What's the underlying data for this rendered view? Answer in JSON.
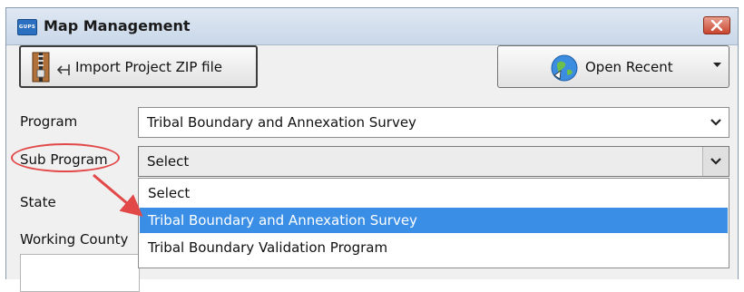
{
  "window": {
    "title": "Map Management",
    "icon_text": "GUPS",
    "close_icon": "close-icon"
  },
  "toolbar": {
    "import_label": "Import Project ZIP file",
    "import_icon": "zip-import-icon",
    "recent_label": "Open Recent",
    "recent_icon": "globe-icon"
  },
  "form": {
    "program_label": "Program",
    "program_value": "Tribal Boundary and Annexation Survey",
    "sub_program_label": "Sub Program",
    "sub_program_value": "Select",
    "state_label": "State",
    "working_county_label": "Working County"
  },
  "dropdown": {
    "options": [
      {
        "label": "Select",
        "selected": false
      },
      {
        "label": "Tribal Boundary and Annexation Survey",
        "selected": true
      },
      {
        "label": "Tribal Boundary Validation Program",
        "selected": false
      }
    ]
  },
  "annotation": {
    "color": "#e24848"
  },
  "colors": {
    "selection": "#3a8ee6",
    "close": "#c8462f"
  }
}
